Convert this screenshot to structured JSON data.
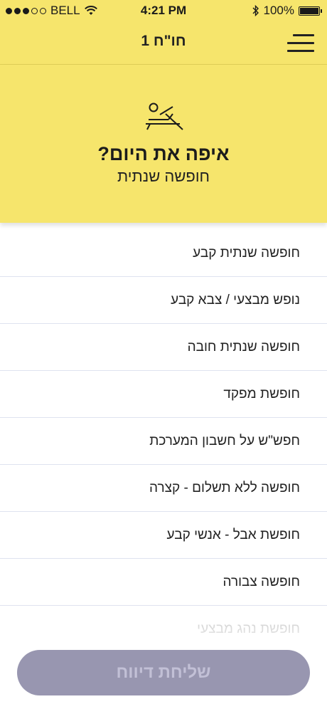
{
  "status_bar": {
    "carrier": "BELL",
    "time": "4:21 PM",
    "battery": "100%",
    "signal_bars_filled": 3,
    "signal_bars_total": 5
  },
  "nav": {
    "title": "חו\"ח 1",
    "menu_icon": "hamburger-menu-icon"
  },
  "hero": {
    "icon": "sunbed-icon",
    "question": "איפה את היום?",
    "answer": "חופשה שנתית"
  },
  "options": [
    {
      "label": "חופשה שנתית קבע"
    },
    {
      "label": "נופש מבצעי / צבא קבע"
    },
    {
      "label": "חופשה שנתית חובה"
    },
    {
      "label": "חופשת מפקד"
    },
    {
      "label": "חפש\"ש על חשבון המערכת"
    },
    {
      "label": "חופשה ללא תשלום - קצרה"
    },
    {
      "label": "חופשת אבל - אנשי קבע"
    },
    {
      "label": "חופשה צבורה"
    },
    {
      "label": "חופשת נהג מבצעי"
    }
  ],
  "submit": {
    "label": "שליחת דיווח"
  },
  "colors": {
    "accent_yellow": "#f6e56c",
    "submit_bg": "#9896b0",
    "submit_text": "#c2c0d6",
    "divider": "#dfe3ef"
  }
}
